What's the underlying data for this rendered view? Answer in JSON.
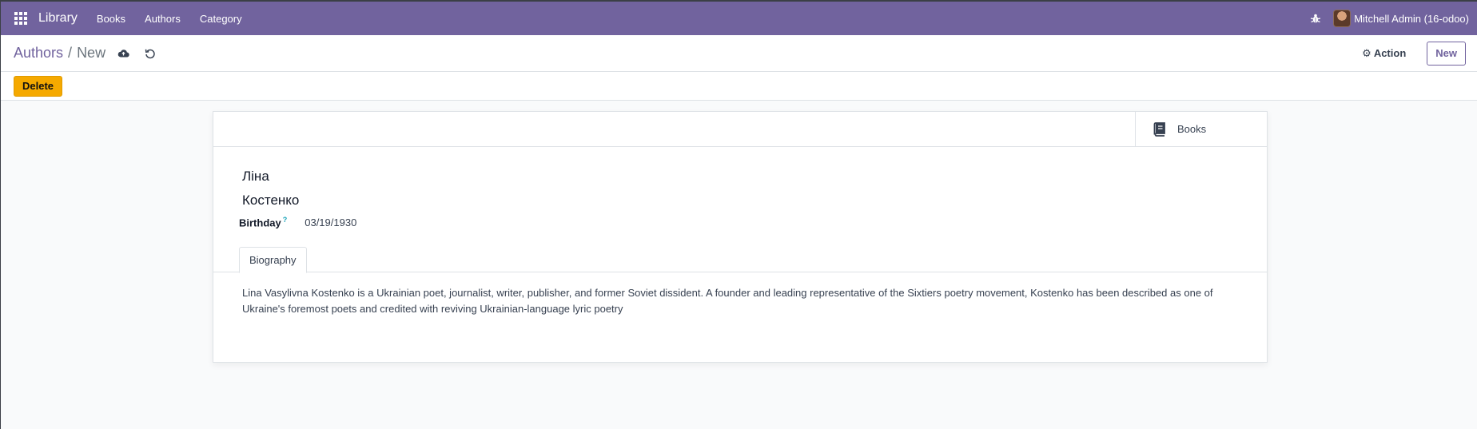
{
  "navbar": {
    "brand": "Library",
    "menu": [
      "Books",
      "Authors",
      "Category"
    ],
    "user": "Mitchell Admin (16-odoo)"
  },
  "control": {
    "breadcrumb_parent": "Authors",
    "breadcrumb_separator": "/",
    "breadcrumb_current": "New",
    "action_label": "Action",
    "new_label": "New"
  },
  "statusbar": {
    "delete_label": "Delete"
  },
  "form": {
    "smart_button_label": "Books",
    "first_name": "Ліна",
    "last_name": "Костенко",
    "birthday_label": "Birthday",
    "birthday_help": "?",
    "birthday_value": "03/19/1930",
    "tab_label": "Biography",
    "biography": "Lina Vasylivna Kostenko is a Ukrainian poet, journalist, writer, publisher, and former Soviet dissident. A founder and leading representative of the Sixtiers poetry movement, Kostenko has been described as one of Ukraine's foremost poets and credited with reviving Ukrainian-language lyric poetry"
  },
  "colors": {
    "brand": "#71639e",
    "delete": "#f5a900"
  }
}
